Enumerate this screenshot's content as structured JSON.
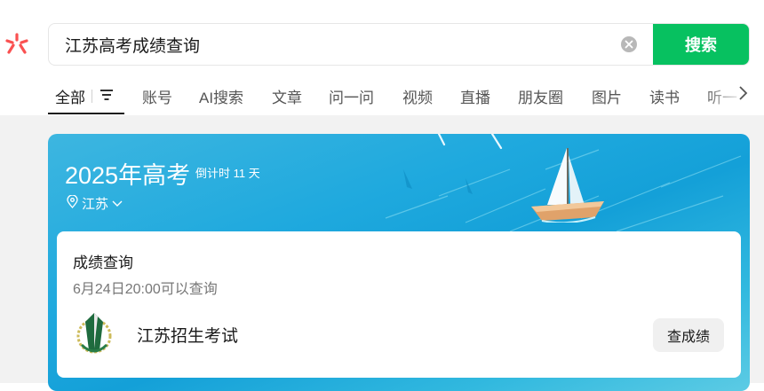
{
  "search": {
    "query": "江苏高考成绩查询",
    "button_label": "搜索"
  },
  "tabs": [
    {
      "label": "全部"
    },
    {
      "label": "账号"
    },
    {
      "label": "AI搜索"
    },
    {
      "label": "文章"
    },
    {
      "label": "问一问"
    },
    {
      "label": "视频"
    },
    {
      "label": "直播"
    },
    {
      "label": "朋友圈"
    },
    {
      "label": "图片"
    },
    {
      "label": "读书"
    },
    {
      "label": "听一"
    }
  ],
  "card": {
    "title": "2025年高考",
    "countdown": "倒计时 11 天",
    "region": "江苏",
    "section_title": "成绩查询",
    "section_sub": "6月24日20:00可以查询",
    "org_name": "江苏招生考试",
    "query_button": "查成绩"
  },
  "colors": {
    "accent_green": "#07c160",
    "card_blue": "#1fa9de",
    "logo_red": "#fa5151"
  },
  "icons": [
    "logo-icon",
    "clear-icon",
    "filter-icon",
    "chevron-right-icon",
    "location-icon",
    "chevron-down-icon",
    "boat-icon",
    "org-logo-icon"
  ]
}
